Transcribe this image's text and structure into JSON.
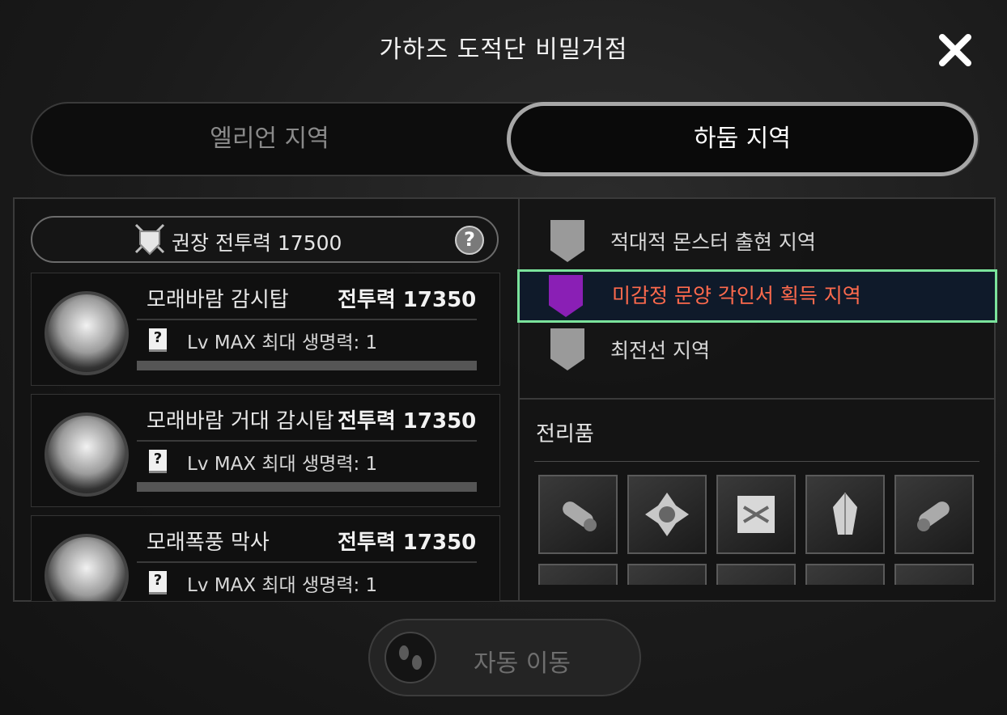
{
  "title": "가하즈 도적단 비밀거점",
  "tabs": [
    {
      "label": "엘리언 지역",
      "selected": false
    },
    {
      "label": "하둠 지역",
      "selected": true
    }
  ],
  "recommended_power": "권장 전투력 17500",
  "help_icon": "?",
  "monsters": [
    {
      "name": "모래바람 감시탑",
      "power": "전투력 17350",
      "stat": "Lv MAX 최대 생명력: 1"
    },
    {
      "name": "모래바람 거대 감시탑",
      "power": "전투력 17350",
      "stat": "Lv MAX 최대 생명력: 1"
    },
    {
      "name": "모래폭풍 막사",
      "power": "전투력 17350",
      "stat": "Lv MAX 최대 생명력: 1"
    }
  ],
  "book_icon_text": "?",
  "categories": [
    {
      "label": "적대적 몬스터 출현 지역",
      "icon": "monster-shield-icon",
      "highlighted": false
    },
    {
      "label": "미감정 문양 각인서 획득 지역",
      "icon": "engraving-scroll-shield-icon",
      "highlighted": true
    },
    {
      "label": "최전선 지역",
      "icon": "frontline-shield-icon",
      "highlighted": false
    }
  ],
  "loot_title": "전리품",
  "loot_items": [
    {
      "icon": "scroll-icon"
    },
    {
      "icon": "emblem-icon"
    },
    {
      "icon": "map-scroll-icon"
    },
    {
      "icon": "crystal-icon"
    },
    {
      "icon": "scroll-icon"
    },
    {
      "icon": "item-icon"
    },
    {
      "icon": "item-icon"
    },
    {
      "icon": "item-icon"
    },
    {
      "icon": "item-icon"
    },
    {
      "icon": "item-icon"
    }
  ],
  "auto_move_label": "자동 이동",
  "colors": {
    "highlight_border": "#7be39c",
    "highlight_text": "#ff6a4d",
    "engraving_badge": "#8a1fb5"
  }
}
